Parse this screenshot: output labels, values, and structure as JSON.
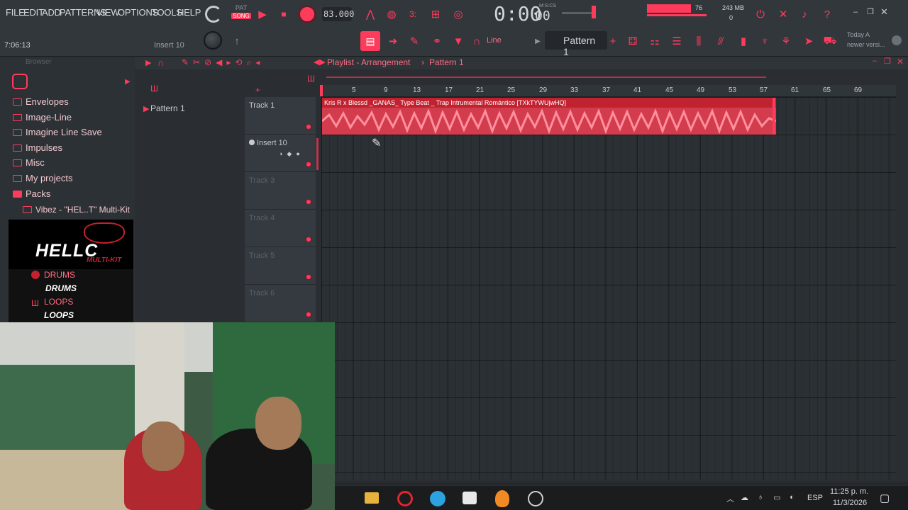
{
  "menu": [
    "FILE",
    "EDIT",
    "ADD",
    "PATTERNS",
    "VIEW",
    "OPTIONS",
    "TOOLS",
    "HELP"
  ],
  "transport": {
    "pat_label": "PAT",
    "song_label": "SONG",
    "tempo": "83.000",
    "time": "0:00",
    "time_sub": "00",
    "time_unit": "M:S:CS",
    "cpu_value": "76",
    "memory": "243 MB",
    "polyphony": "0"
  },
  "status": {
    "elapsed": "7:06:13",
    "focused_channel": "Insert 10",
    "snap_mode": "Line",
    "pattern_selector": "Pattern 1",
    "news_line1": "Today  A",
    "news_line2": "newer versi..."
  },
  "browser": {
    "title": "Browser",
    "items": [
      {
        "label": "Envelopes"
      },
      {
        "label": "Image-Line"
      },
      {
        "label": "Imagine Line Save"
      },
      {
        "label": "Impulses"
      },
      {
        "label": "Misc"
      },
      {
        "label": "My projects"
      },
      {
        "label": "Packs"
      }
    ],
    "subfolder": "Vibez - \"HEL..T\" Multi-Kit",
    "logo_text": "HELLC",
    "logo_sub": "MULTI-KIT",
    "drums_label": "DRUMS",
    "drums_banner": "DRUMS",
    "loops_label": "LOOPS",
    "loops_banner": "LOOPS"
  },
  "playlist": {
    "title_prefix": "Playlist - Arrangement",
    "title_sep": "›",
    "title_pattern": "Pattern 1",
    "pattern_list_item": "Pattern 1",
    "ruler_ticks": [
      "5",
      "9",
      "13",
      "17",
      "21",
      "25",
      "29",
      "33",
      "37",
      "41",
      "45",
      "49",
      "53",
      "57",
      "61",
      "65",
      "69"
    ],
    "tracks": [
      {
        "name": "Track 1"
      },
      {
        "name": "Insert 10"
      },
      {
        "name": "Track 3"
      },
      {
        "name": "Track 4"
      },
      {
        "name": "Track 5"
      },
      {
        "name": "Track 6"
      }
    ],
    "clip_title": "Kris R x Blessd _GANAS_ Type Beat _ Trap Intrumental Romántico [TXkTYWUjwHQ]"
  },
  "taskbar": {
    "lang": "ESP",
    "time": "11:25 p. m.",
    "date": "11/3/2026"
  },
  "colors": {
    "accent": "#ff3b5c",
    "clip": "#d23c4c",
    "background": "#25292d"
  }
}
